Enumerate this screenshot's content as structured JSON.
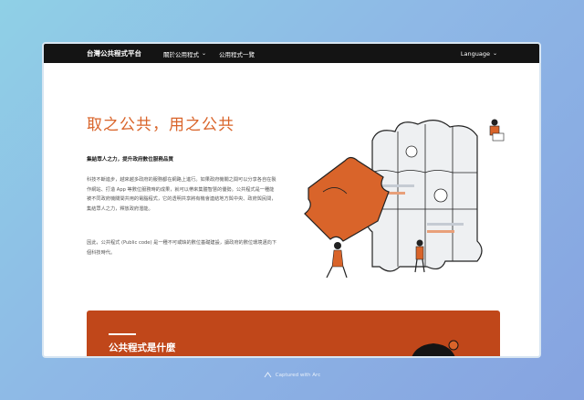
{
  "nav": {
    "brand": "台灣公共程式平台",
    "item1": "關於公用程式",
    "item2": "公用程式一覽",
    "language": "Language"
  },
  "hero": {
    "title": "取之公共，用之公共",
    "subtitle": "集結眾人之力，提升政府數位服務品質",
    "p1": "科技不斷進步，越來越多政府的服務都在網路上進行。如果政府機關之間可以分享各自在製作網站、打造 App 等數位服務時的成果，就可以帶來集體智慧的優勢。公共程式是一種能被不同政府機關間共用的電腦程式，它的透明共享將有機會連結地方與中央、政府與民間，集結眾人之力，釋放政府潛能。",
    "p2": "因此，公共程式 (Public code) 是一種不可或缺的數位基礎建設，讓政府的數位環境邁向下個科技時代。"
  },
  "section": {
    "title": "公共程式是什麼"
  },
  "footer": {
    "captured": "Captured with Arc"
  },
  "colors": {
    "accent": "#d9642a",
    "section_bg": "#c0471a",
    "topbar": "#141414"
  },
  "icons": {
    "nav_chevron": "chevron-down-icon",
    "capture": "arc-icon"
  }
}
